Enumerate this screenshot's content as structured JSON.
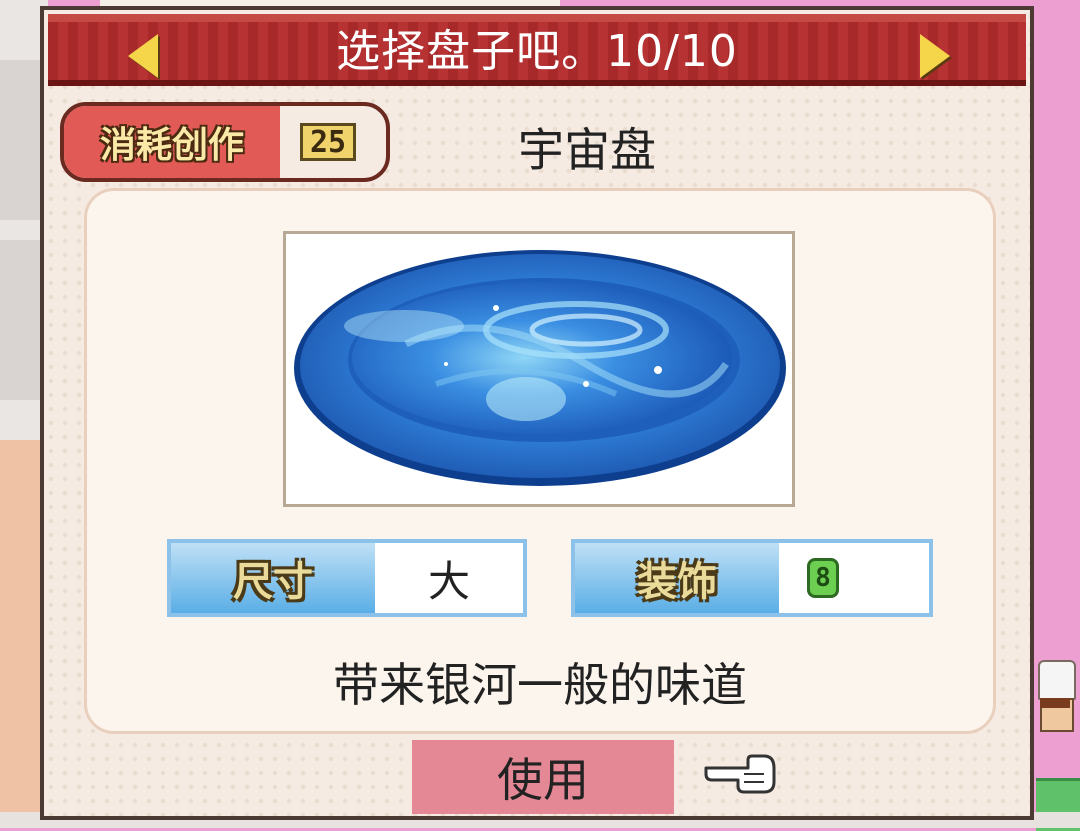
{
  "dialog": {
    "title": "选择盘子吧。10/10",
    "cost_label": "消耗创作",
    "cost_value": "25",
    "dish_name": "宇宙盘",
    "image_icon": "cosmic-plate-icon",
    "stats": {
      "size_label": "尺寸",
      "size_value": "大",
      "deco_label": "装饰",
      "deco_value": "8"
    },
    "description": "带来银河一般的味道",
    "use_button": "使用"
  },
  "colors": {
    "title_bar": "#a8292a",
    "accent_yellow": "#f5d54a",
    "cost_badge": "#e25a55",
    "use_button": "#e48896",
    "stat_label_blue": "#5aaee6"
  }
}
